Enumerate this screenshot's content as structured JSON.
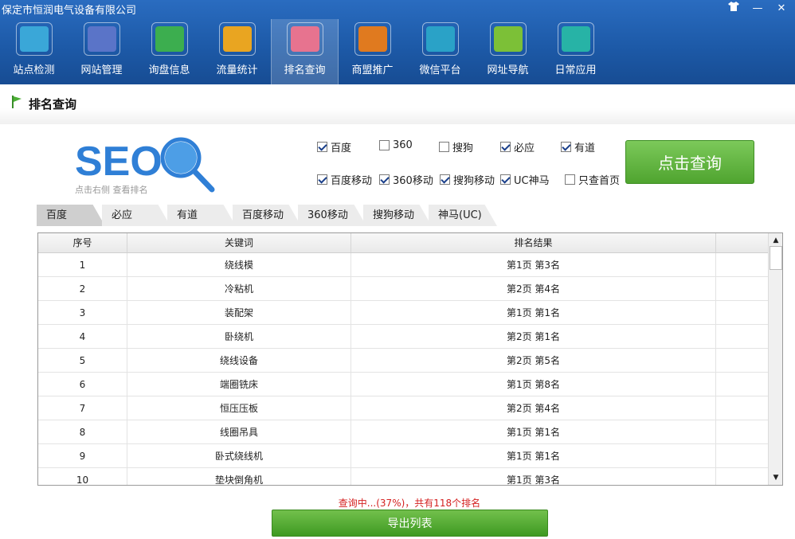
{
  "app": {
    "title": "保定市恒润电气设备有限公司"
  },
  "window": {
    "skin_icon": "shirt-icon",
    "minimize": "—",
    "close": "✕"
  },
  "nav": {
    "items": [
      {
        "label": "站点检测",
        "icon": "radar-icon",
        "color": "#3aa7d8"
      },
      {
        "label": "网站管理",
        "icon": "tools-icon",
        "color": "#5a74c8"
      },
      {
        "label": "询盘信息",
        "icon": "chat-icon",
        "color": "#3cae4f"
      },
      {
        "label": "流量统计",
        "icon": "trend-icon",
        "color": "#e9a521"
      },
      {
        "label": "排名查询",
        "icon": "bar-chart-icon",
        "color": "#e7738f"
      },
      {
        "label": "商盟推广",
        "icon": "people-icon",
        "color": "#e07a1f"
      },
      {
        "label": "微信平台",
        "icon": "wechat-icon",
        "color": "#2aa2c7"
      },
      {
        "label": "网址导航",
        "icon": "mouse-icon",
        "color": "#7cc037"
      },
      {
        "label": "日常应用",
        "icon": "grid-icon",
        "color": "#27b3a6"
      }
    ],
    "active_index": 4
  },
  "section": {
    "title": "排名查询"
  },
  "logo": {
    "text": "SEO",
    "sub": "点击右侧 查看排名"
  },
  "options": [
    {
      "label": "百度",
      "checked": true
    },
    {
      "label": "360",
      "checked": false
    },
    {
      "label": "搜狗",
      "checked": false
    },
    {
      "label": "必应",
      "checked": true
    },
    {
      "label": "有道",
      "checked": true
    },
    {
      "label": "百度移动",
      "checked": true
    },
    {
      "label": "360移动",
      "checked": true
    },
    {
      "label": "搜狗移动",
      "checked": true
    },
    {
      "label": "UC神马",
      "checked": true
    },
    {
      "label": "只查首页",
      "checked": false
    }
  ],
  "query_button": "点击查询",
  "tabs": [
    "百度",
    "必应",
    "有道",
    "百度移动",
    "360移动",
    "搜狗移动",
    "神马(UC)"
  ],
  "active_tab": 0,
  "table": {
    "headers": [
      "序号",
      "关键词",
      "排名结果"
    ],
    "rows": [
      [
        "1",
        "绕线模",
        "第1页 第3名"
      ],
      [
        "2",
        "冷粘机",
        "第2页 第4名"
      ],
      [
        "3",
        "装配架",
        "第1页 第1名"
      ],
      [
        "4",
        "卧绕机",
        "第2页 第1名"
      ],
      [
        "5",
        "绕线设备",
        "第2页 第5名"
      ],
      [
        "6",
        "端圈铣床",
        "第1页 第8名"
      ],
      [
        "7",
        "恒压压板",
        "第2页 第4名"
      ],
      [
        "8",
        "线圈吊具",
        "第1页 第1名"
      ],
      [
        "9",
        "卧式绕线机",
        "第1页 第1名"
      ],
      [
        "10",
        "垫块倒角机",
        "第1页 第3名"
      ]
    ]
  },
  "status": "查询中...(37%)，共有118个排名",
  "export_button": "导出列表"
}
